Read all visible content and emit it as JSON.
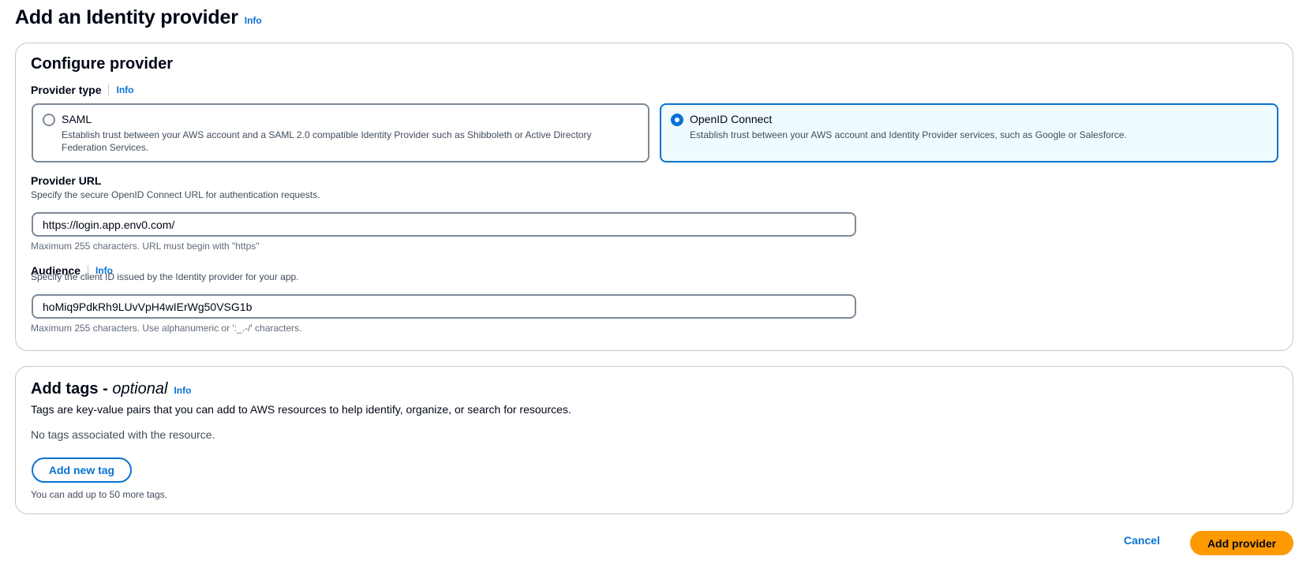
{
  "page": {
    "title": "Add an Identity provider",
    "info": "Info"
  },
  "configure": {
    "title": "Configure provider",
    "provider_type": {
      "label": "Provider type",
      "info": "Info",
      "options": [
        {
          "label": "SAML",
          "description": "Establish trust between your AWS account and a SAML 2.0 compatible Identity Provider such as Shibboleth or Active Directory Federation Services.",
          "selected": false
        },
        {
          "label": "OpenID Connect",
          "description": "Establish trust between your AWS account and Identity Provider services, such as Google or Salesforce.",
          "selected": true
        }
      ]
    },
    "provider_url": {
      "label": "Provider URL",
      "description": "Specify the secure OpenID Connect URL for authentication requests.",
      "value": "https://login.app.env0.com/",
      "constraint": "Maximum 255 characters. URL must begin with \"https\""
    },
    "audience": {
      "label": "Audience",
      "info": "Info",
      "description": "Specify the client ID issued by the Identity provider for your app.",
      "value": "hoMiq9PdkRh9LUvVpH4wIErWg50VSG1b",
      "constraint": "Maximum 255 characters. Use alphanumeric or ':_.-/' characters."
    }
  },
  "tags": {
    "title": "Add tags - ",
    "title_optional": "optional",
    "info": "Info",
    "description": "Tags are key-value pairs that you can add to AWS resources to help identify, organize, or search for resources.",
    "empty": "No tags associated with the resource.",
    "add_button": "Add new tag",
    "limit_note": "You can add up to 50 more tags."
  },
  "footer": {
    "cancel": "Cancel",
    "submit": "Add provider"
  },
  "colors": {
    "link": "#0972d3",
    "primary_button": "#ff9900",
    "selected_tile_bg": "#f0fbff",
    "border": "#7d8998"
  }
}
